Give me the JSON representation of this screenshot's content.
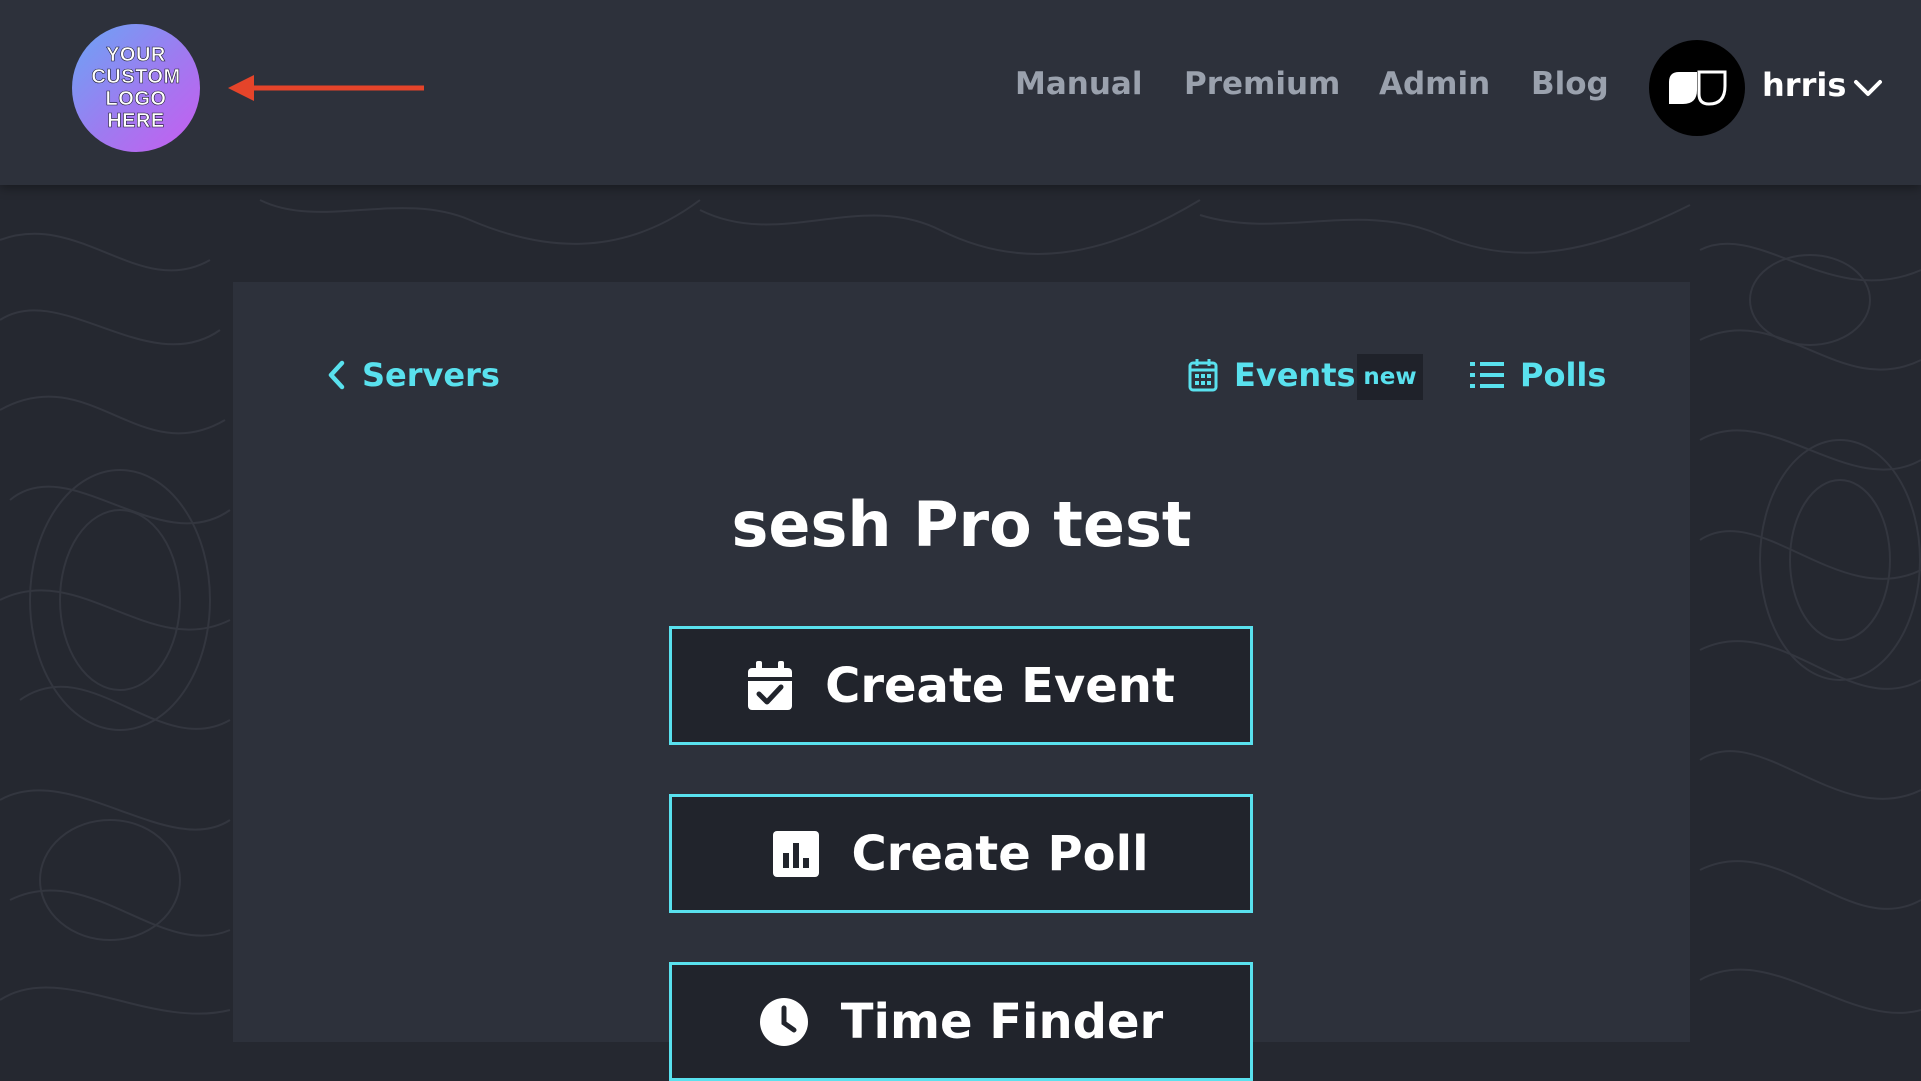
{
  "header": {
    "logo_lines": [
      "YOUR",
      "CUSTOM",
      "LOGO",
      "HERE"
    ],
    "nav": [
      {
        "label": "Manual"
      },
      {
        "label": "Premium"
      },
      {
        "label": "Admin"
      },
      {
        "label": "Blog"
      }
    ],
    "user": {
      "name": "hrris"
    }
  },
  "card": {
    "back_link": "Servers",
    "events_link": "Events",
    "events_badge": "new",
    "polls_link": "Polls",
    "title": "sesh Pro test",
    "actions": [
      {
        "label": "Create Event",
        "icon": "calendar-check-icon"
      },
      {
        "label": "Create Poll",
        "icon": "bar-chart-icon"
      },
      {
        "label": "Time Finder",
        "icon": "clock-icon"
      }
    ]
  },
  "colors": {
    "accent": "#59e1ee",
    "header_bg": "#2d313b",
    "page_bg": "#252830",
    "annotation_arrow": "#e5442a"
  }
}
